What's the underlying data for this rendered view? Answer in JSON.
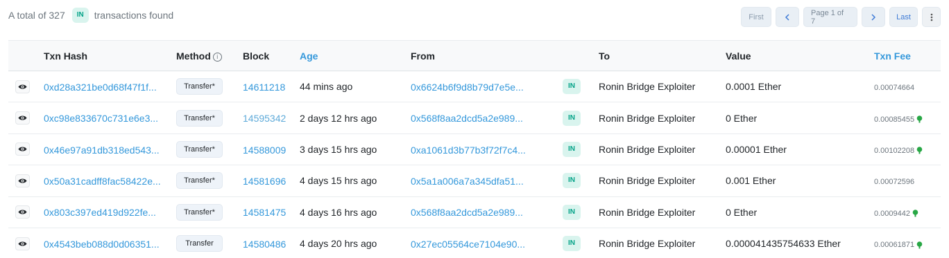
{
  "summary": {
    "prefix": "A total of 327",
    "badge": "IN",
    "suffix": "transactions found"
  },
  "pager": {
    "first": "First",
    "prev_icon": "chevron-left-icon",
    "page": "Page 1 of 7",
    "next_icon": "chevron-right-icon",
    "last": "Last",
    "more_icon": "more-vertical-icon"
  },
  "columns": [
    "",
    "Txn Hash",
    "Method",
    "Block",
    "Age",
    "From",
    "",
    "To",
    "Value",
    "Txn Fee"
  ],
  "colors": {
    "link": "#3498db",
    "in_badge_bg": "#d9f4ee",
    "in_badge_text": "#00a186",
    "fee_icon": "#28a745"
  },
  "rows": [
    {
      "hash": "0xd28a321be0d68f47f1f...",
      "method": "Transfer*",
      "block": "14611218",
      "age": "44 mins ago",
      "from": "0x6624b6f9d8b79d7e5e...",
      "dir": "IN",
      "to": "Ronin Bridge Exploiter",
      "value_int": "0.",
      "value_dec": "0001 Ether",
      "fee": "0.00074664",
      "fee_icon": false
    },
    {
      "hash": "0xc98e833670c731e6e3...",
      "method": "Transfer*",
      "block": "14595342",
      "age": "2 days 12 hrs ago",
      "from": "0x568f8aa2dcd5a2e989...",
      "dir": "IN",
      "to": "Ronin Bridge Exploiter",
      "value_int": "0",
      "value_dec": " Ether",
      "fee": "0.00085455",
      "fee_icon": true
    },
    {
      "hash": "0x46e97a91db318ed543...",
      "method": "Transfer*",
      "block": "14588009",
      "age": "3 days 15 hrs ago",
      "from": "0xa1061d3b77b3f72f7c4...",
      "dir": "IN",
      "to": "Ronin Bridge Exploiter",
      "value_int": "0.",
      "value_dec": "00001 Ether",
      "fee": "0.00102208",
      "fee_icon": true
    },
    {
      "hash": "0x50a31cadff8fac58422e...",
      "method": "Transfer*",
      "block": "14581696",
      "age": "4 days 15 hrs ago",
      "from": "0x5a1a006a7a345dfa51...",
      "dir": "IN",
      "to": "Ronin Bridge Exploiter",
      "value_int": "0.",
      "value_dec": "001 Ether",
      "fee": "0.00072596",
      "fee_icon": false
    },
    {
      "hash": "0x803c397ed419d922fe...",
      "method": "Transfer*",
      "block": "14581475",
      "age": "4 days 16 hrs ago",
      "from": "0x568f8aa2dcd5a2e989...",
      "dir": "IN",
      "to": "Ronin Bridge Exploiter",
      "value_int": "0",
      "value_dec": " Ether",
      "fee": "0.0009442",
      "fee_icon": true
    },
    {
      "hash": "0x4543beb088d0d06351...",
      "method": "Transfer",
      "block": "14580486",
      "age": "4 days 20 hrs ago",
      "from": "0x27ec05564ce7104e90...",
      "dir": "IN",
      "to": "Ronin Bridge Exploiter",
      "value_int": "0.",
      "value_dec": "000041435754633 Ether",
      "fee": "0.00061871",
      "fee_icon": true
    }
  ]
}
